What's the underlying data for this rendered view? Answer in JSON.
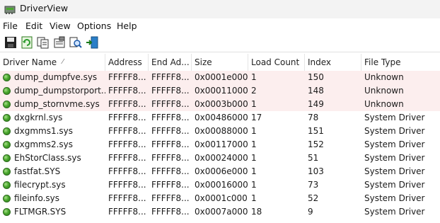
{
  "window": {
    "title": "DriverView"
  },
  "menu": [
    "File",
    "Edit",
    "View",
    "Options",
    "Help"
  ],
  "toolbar": {
    "icons": [
      "save-icon",
      "refresh-icon",
      "copy-icon",
      "properties-icon",
      "find-icon",
      "exit-icon"
    ]
  },
  "columns": [
    "Driver Name",
    "Address",
    "End Ad...",
    "Size",
    "Load Count",
    "Index",
    "File Type"
  ],
  "sort_indicator": "⁄",
  "colors": {
    "flagged_row": "#fceeee",
    "status_dot": "#4aa82e"
  },
  "rows": [
    {
      "name": "dump_dumpfve.sys",
      "address": "FFFFF8...",
      "end": "FFFFF8...",
      "size": "0x0001e000",
      "load": "1",
      "index": "150",
      "type": "Unknown",
      "flag": true
    },
    {
      "name": "dump_dumpstorport....",
      "address": "FFFFF8...",
      "end": "FFFFF8...",
      "size": "0x00011000",
      "load": "2",
      "index": "148",
      "type": "Unknown",
      "flag": true
    },
    {
      "name": "dump_stornvme.sys",
      "address": "FFFFF8...",
      "end": "FFFFF8...",
      "size": "0x0003b000",
      "load": "1",
      "index": "149",
      "type": "Unknown",
      "flag": true
    },
    {
      "name": "dxgkrnl.sys",
      "address": "FFFFF8...",
      "end": "FFFFF8...",
      "size": "0x00486000",
      "load": "17",
      "index": "78",
      "type": "System Driver",
      "flag": false
    },
    {
      "name": "dxgmms1.sys",
      "address": "FFFFF8...",
      "end": "FFFFF8...",
      "size": "0x00088000",
      "load": "1",
      "index": "151",
      "type": "System Driver",
      "flag": false
    },
    {
      "name": "dxgmms2.sys",
      "address": "FFFFF8...",
      "end": "FFFFF8...",
      "size": "0x00117000",
      "load": "1",
      "index": "152",
      "type": "System Driver",
      "flag": false
    },
    {
      "name": "EhStorClass.sys",
      "address": "FFFFF8...",
      "end": "FFFFF8...",
      "size": "0x00024000",
      "load": "1",
      "index": "51",
      "type": "System Driver",
      "flag": false
    },
    {
      "name": "fastfat.SYS",
      "address": "FFFFF8...",
      "end": "FFFFF8...",
      "size": "0x0006e000",
      "load": "1",
      "index": "103",
      "type": "System Driver",
      "flag": false
    },
    {
      "name": "filecrypt.sys",
      "address": "FFFFF8...",
      "end": "FFFFF8...",
      "size": "0x00016000",
      "load": "1",
      "index": "73",
      "type": "System Driver",
      "flag": false
    },
    {
      "name": "fileinfo.sys",
      "address": "FFFFF8...",
      "end": "FFFFF8...",
      "size": "0x0001c000",
      "load": "1",
      "index": "52",
      "type": "System Driver",
      "flag": false
    },
    {
      "name": "FLTMGR.SYS",
      "address": "FFFFF8...",
      "end": "FFFFF8...",
      "size": "0x0007a000",
      "load": "18",
      "index": "9",
      "type": "System Driver",
      "flag": false
    }
  ]
}
